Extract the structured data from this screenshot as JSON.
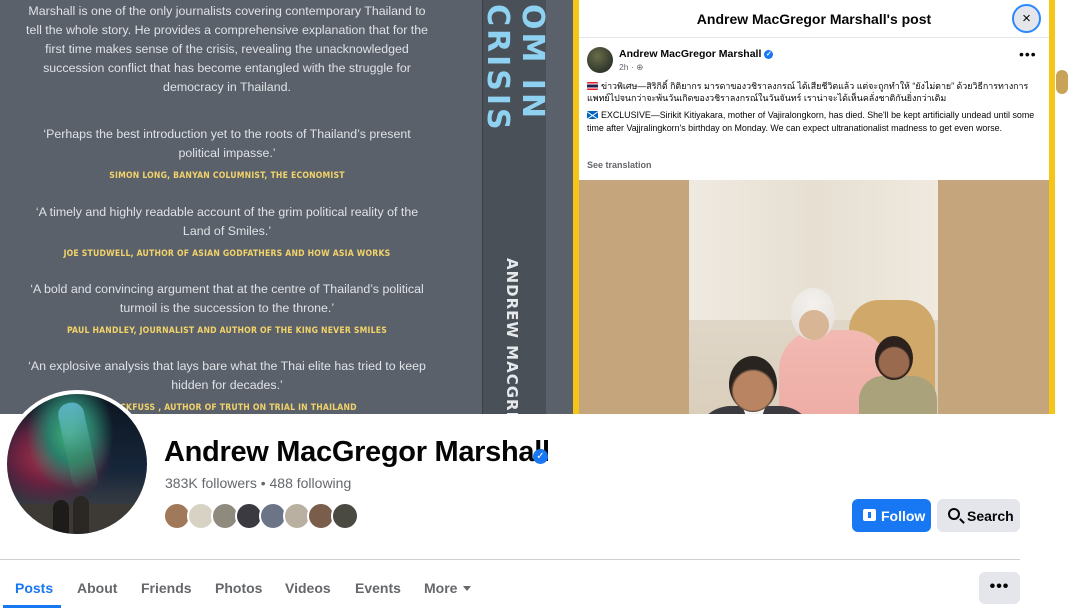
{
  "book": {
    "intro": "Marshall is one of the only journalists covering contemporary Thailand to tell the whole story. He provides a comprehensive explanation that for the first time makes sense of the crisis, revealing the unacknowledged succession conflict that has become entangled with the struggle for democracy in Thailand.",
    "quotes": [
      {
        "text": "‘Perhaps the best introduction yet to the roots of Thailand’s present political impasse.’",
        "attribution": "SIMON LONG, BANYAN COLUMNIST, THE ECONOMIST"
      },
      {
        "text": "‘A timely and highly readable account of the grim political reality of the Land of Smiles.’",
        "attribution": "JOE STUDWELL, AUTHOR OF ASIAN GODFATHERS AND HOW ASIA WORKS"
      },
      {
        "text": "‘A bold and convincing argument that at the centre of Thailand’s political turmoil is the succession to the throne.’",
        "attribution": "PAUL HANDLEY, JOURNALIST AND AUTHOR OF THE KING NEVER SMILES"
      },
      {
        "text": "‘An explosive analysis that lays bare what the Thai elite has tried to keep hidden for decades.’",
        "attribution": "STRECKFUSS , AUTHOR OF TRUTH ON TRIAL IN THAILAND"
      }
    ],
    "spine_title": "OM IN CRISIS",
    "spine_author": "ANDREW MACGREG"
  },
  "post": {
    "header_title": "Andrew MacGregor Marshall's post",
    "close_icon": "×",
    "author": "Andrew MacGregor Marshall",
    "verified_icon": "✓",
    "time": "2h · ",
    "privacy_icon": "⊕",
    "more_icon": "•••",
    "thai_text": "ข่าวพิเศษ—สิริกิติ์ กิติยากร มารดาของวชิราลงกรณ์ ได้เสียชีวิตแล้ว แต่จะถูกทำให้ “ยังไม่ตาย” ด้วยวิธีการทางการแพทย์ไปจนกว่าจะพ้นวันเกิดของวชิราลงกรณ์ในวันจันทร์ เราน่าจะได้เห็นคลั่งชาติกันยิ่งกว่าเดิม",
    "english_text": "EXCLUSIVE—Sirikit Kitiyakara, mother of Vajiralongkorn, has died. She'll be kept artificially undead until some time after Vajjralingkorn's birthday on Monday. We can expect ultranationalist madness to get even worse.",
    "see_translation": "See translation"
  },
  "profile": {
    "name": "Andrew MacGregor Marshall",
    "verified_icon": "✓",
    "stats": "383K followers • 488 following",
    "follow_label": "Follow",
    "search_label": "Search",
    "follower_colors": [
      "#a0785a",
      "#d8d2c4",
      "#8f8a7e",
      "#3a3a40",
      "#6c7488",
      "#b9b0a2",
      "#7a5d4a",
      "#4a4a42"
    ],
    "more_icon": "•••"
  },
  "tabs": [
    {
      "label": "Posts"
    },
    {
      "label": "About"
    },
    {
      "label": "Friends"
    },
    {
      "label": "Photos"
    },
    {
      "label": "Videos"
    },
    {
      "label": "Events"
    },
    {
      "label": "More"
    }
  ],
  "colors": {
    "accent": "#1877f2",
    "highlight": "#f5c518",
    "quote_attr": "#f2d36a"
  }
}
